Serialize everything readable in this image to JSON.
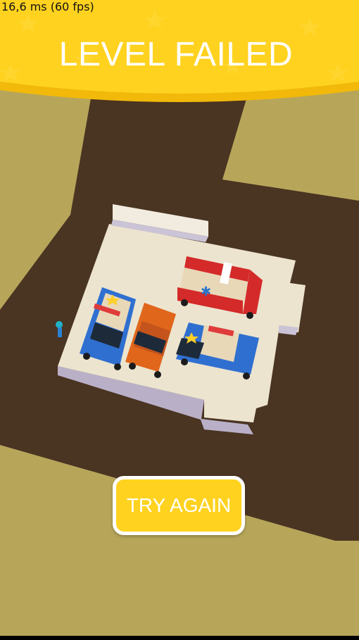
{
  "fps_readout": "16,6 ms (60 fps)",
  "banner": {
    "title": "LEVEL FAILED"
  },
  "try_again_button": {
    "label": "TRY AGAIN"
  },
  "vehicles": [
    {
      "type": "police-car",
      "body_color": "#2f6fd0"
    },
    {
      "type": "sedan",
      "body_color": "#e0661c"
    },
    {
      "type": "ambulance",
      "body_color": "#d42a2a"
    },
    {
      "type": "police-car",
      "body_color": "#2f6fd0"
    }
  ],
  "colors": {
    "ground": "#b7a65a",
    "road": "#4a3422",
    "parking_lot": "#ece4cf",
    "banner": "#ffd21f",
    "button": "#ffd21f"
  }
}
